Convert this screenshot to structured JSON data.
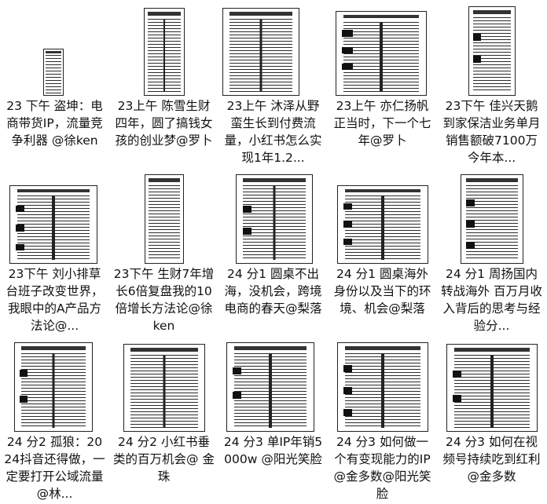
{
  "items": [
    {
      "title": "23 下午 盗坤：电商带货IP，流量竞争利器 @徐ken",
      "icon": "document-thumbnail-icon"
    },
    {
      "title": "23上午 陈雪生财四年，圆了搞钱女孩的创业梦@罗卜",
      "icon": "document-thumbnail-icon"
    },
    {
      "title": "23上午 沐泽从野蛮生长到付费流量，小红书怎么实现1年1.2...",
      "icon": "document-thumbnail-icon"
    },
    {
      "title": "23上午 亦仁扬帆正当时，下一个七年@罗卜",
      "icon": "document-thumbnail-icon"
    },
    {
      "title": "23下午 佳兴天鹅到家保洁业务单月销售额破7100万今年本...",
      "icon": "document-thumbnail-icon"
    },
    {
      "title": "23下午 刘小排草台班子改变世界，我眼中的A产品方法论@...",
      "icon": "document-thumbnail-icon"
    },
    {
      "title": "23下午 生财7年增长6倍复盘我的10倍增长方法论@徐ken",
      "icon": "document-thumbnail-icon"
    },
    {
      "title": "24 分1 圆桌不出海，没机会，跨境电商的春天@梨落",
      "icon": "document-thumbnail-icon"
    },
    {
      "title": "24 分1 圆桌海外身份以及当下的环境、机会@梨落",
      "icon": "document-thumbnail-icon"
    },
    {
      "title": "24 分1 周扬国内转战海外 百万月收入背后的思考与经验分...",
      "icon": "document-thumbnail-icon"
    },
    {
      "title": "24 分2 孤狼：2024抖音还得做，一定要打开公域流量@林...",
      "icon": "document-thumbnail-icon"
    },
    {
      "title": "24 分2 小红书垂类的百万机会@ 金珠",
      "icon": "document-thumbnail-icon"
    },
    {
      "title": "24 分3 单IP年销5000w @阳光笑脸",
      "icon": "document-thumbnail-icon"
    },
    {
      "title": "24 分3 如何做一个有变现能力的IP@金多数@阳光笑脸",
      "icon": "document-thumbnail-icon"
    },
    {
      "title": "24 分3 如何在视频号持续吃到红利@金多数",
      "icon": "document-thumbnail-icon"
    }
  ]
}
